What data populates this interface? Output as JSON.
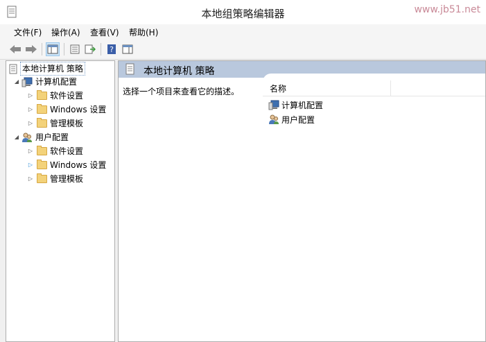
{
  "window": {
    "title": "本地组策略编辑器",
    "watermark": "www.jb51.net"
  },
  "menu": {
    "items": [
      {
        "label": "文件(F)"
      },
      {
        "label": "操作(A)"
      },
      {
        "label": "查看(V)"
      },
      {
        "label": "帮助(H)"
      }
    ]
  },
  "toolbar": {
    "buttons": [
      {
        "icon": "back-arrow-icon"
      },
      {
        "icon": "forward-arrow-icon"
      },
      {
        "icon": "show-hide-console-tree-icon",
        "active": true
      },
      {
        "icon": "properties-icon"
      },
      {
        "icon": "export-list-icon"
      },
      {
        "icon": "help-icon"
      },
      {
        "icon": "action-pane-icon"
      }
    ]
  },
  "tree": {
    "root": "本地计算机 策略",
    "computer_config": "计算机配置",
    "computer_children": [
      "软件设置",
      "Windows 设置",
      "管理模板"
    ],
    "user_config": "用户配置",
    "user_children": [
      "软件设置",
      "Windows 设置",
      "管理模板"
    ]
  },
  "details": {
    "header_title": "本地计算机 策略",
    "description": "选择一个项目来查看它的描述。",
    "column_name": "名称",
    "rows": [
      "计算机配置",
      "用户配置"
    ]
  }
}
